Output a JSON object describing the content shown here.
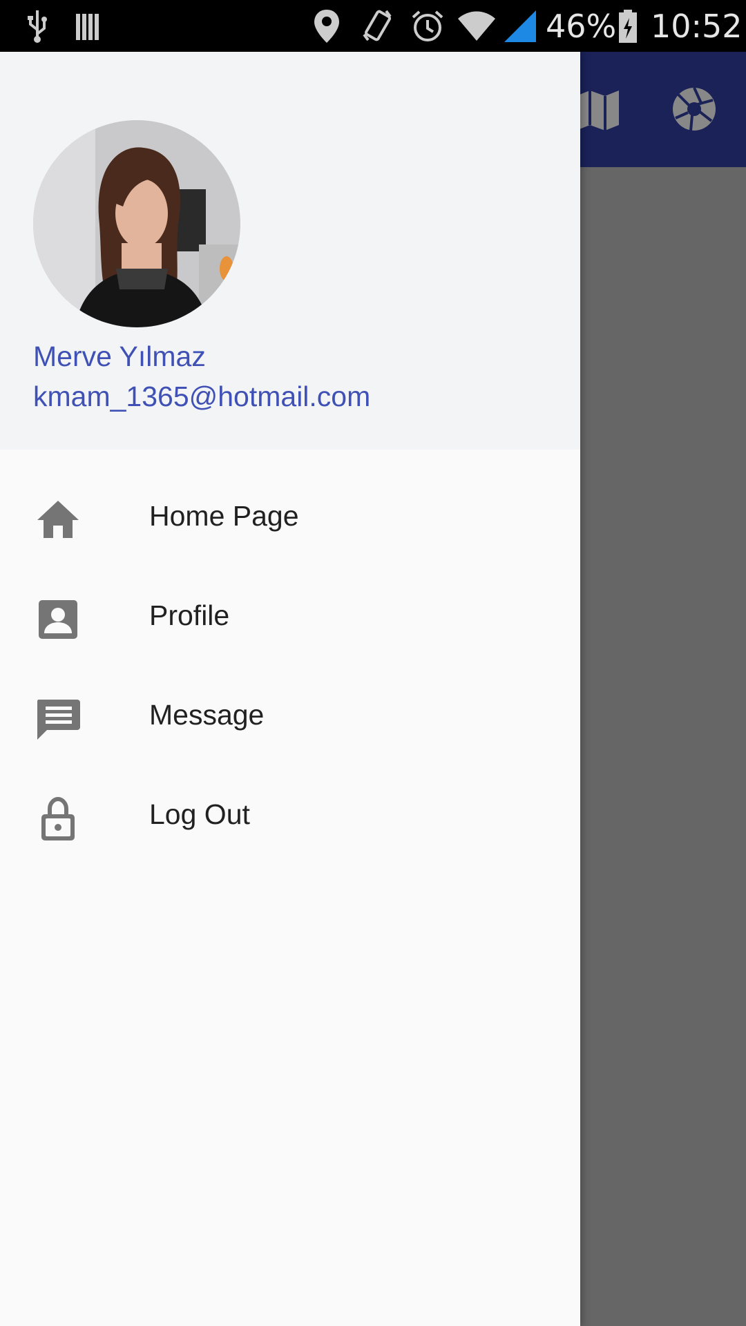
{
  "status_bar": {
    "battery_percent": "46%",
    "time": "10:52",
    "icons": [
      "usb-icon",
      "storage-icon",
      "location-icon",
      "vibrate-icon",
      "alarm-icon",
      "wifi-icon",
      "signal-icon",
      "battery-icon"
    ]
  },
  "app_bar": {
    "icons": [
      "map-icon",
      "camera-shutter-icon"
    ],
    "color": "#1a2258"
  },
  "drawer": {
    "user": {
      "name": "Merve Yılmaz",
      "email": "kmam_1365@hotmail.com"
    },
    "accent_color": "#3f51b5",
    "items": [
      {
        "label": "Home Page",
        "icon": "home-icon"
      },
      {
        "label": "Profile",
        "icon": "account-box-icon"
      },
      {
        "label": "Message",
        "icon": "message-icon"
      },
      {
        "label": "Log Out",
        "icon": "lock-icon"
      }
    ]
  }
}
